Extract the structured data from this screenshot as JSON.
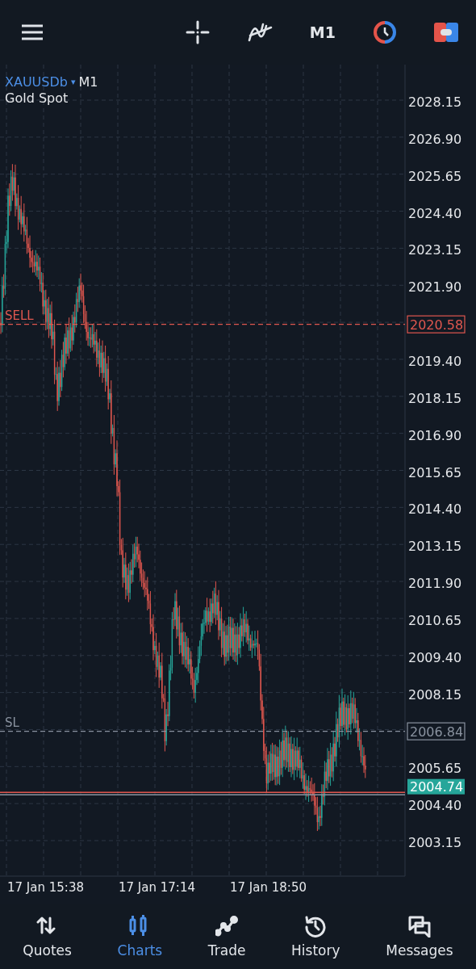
{
  "toolbar": {
    "timeframe": "M1"
  },
  "symbol": {
    "name": "XAUUSDb",
    "dropdown": "▾",
    "timeframe": "M1",
    "description": "Gold Spot"
  },
  "price_axis": [
    "2028.15",
    "2026.90",
    "2025.65",
    "2024.40",
    "2023.15",
    "2021.90",
    "2019.40",
    "2018.15",
    "2016.90",
    "2015.65",
    "2014.40",
    "2013.15",
    "2011.90",
    "2010.65",
    "2009.40",
    "2008.15",
    "2005.65",
    "2004.40",
    "2003.15"
  ],
  "order_lines": [
    {
      "kind": "sell",
      "label": "SELL",
      "price": "2020.58"
    },
    {
      "kind": "sl",
      "label": "SL",
      "price": "2006.84"
    },
    {
      "kind": "bid",
      "price": "2004.74"
    }
  ],
  "time_axis": [
    "17 Jan 15:38",
    "17 Jan 17:14",
    "17 Jan 18:50"
  ],
  "nav": [
    {
      "label": "Quotes",
      "kind": "quotes",
      "selected": false
    },
    {
      "label": "Charts",
      "kind": "charts",
      "selected": true
    },
    {
      "label": "Trade",
      "kind": "trade",
      "selected": false
    },
    {
      "label": "History",
      "kind": "history",
      "selected": false
    },
    {
      "label": "Messages",
      "kind": "messages",
      "selected": false
    }
  ]
}
